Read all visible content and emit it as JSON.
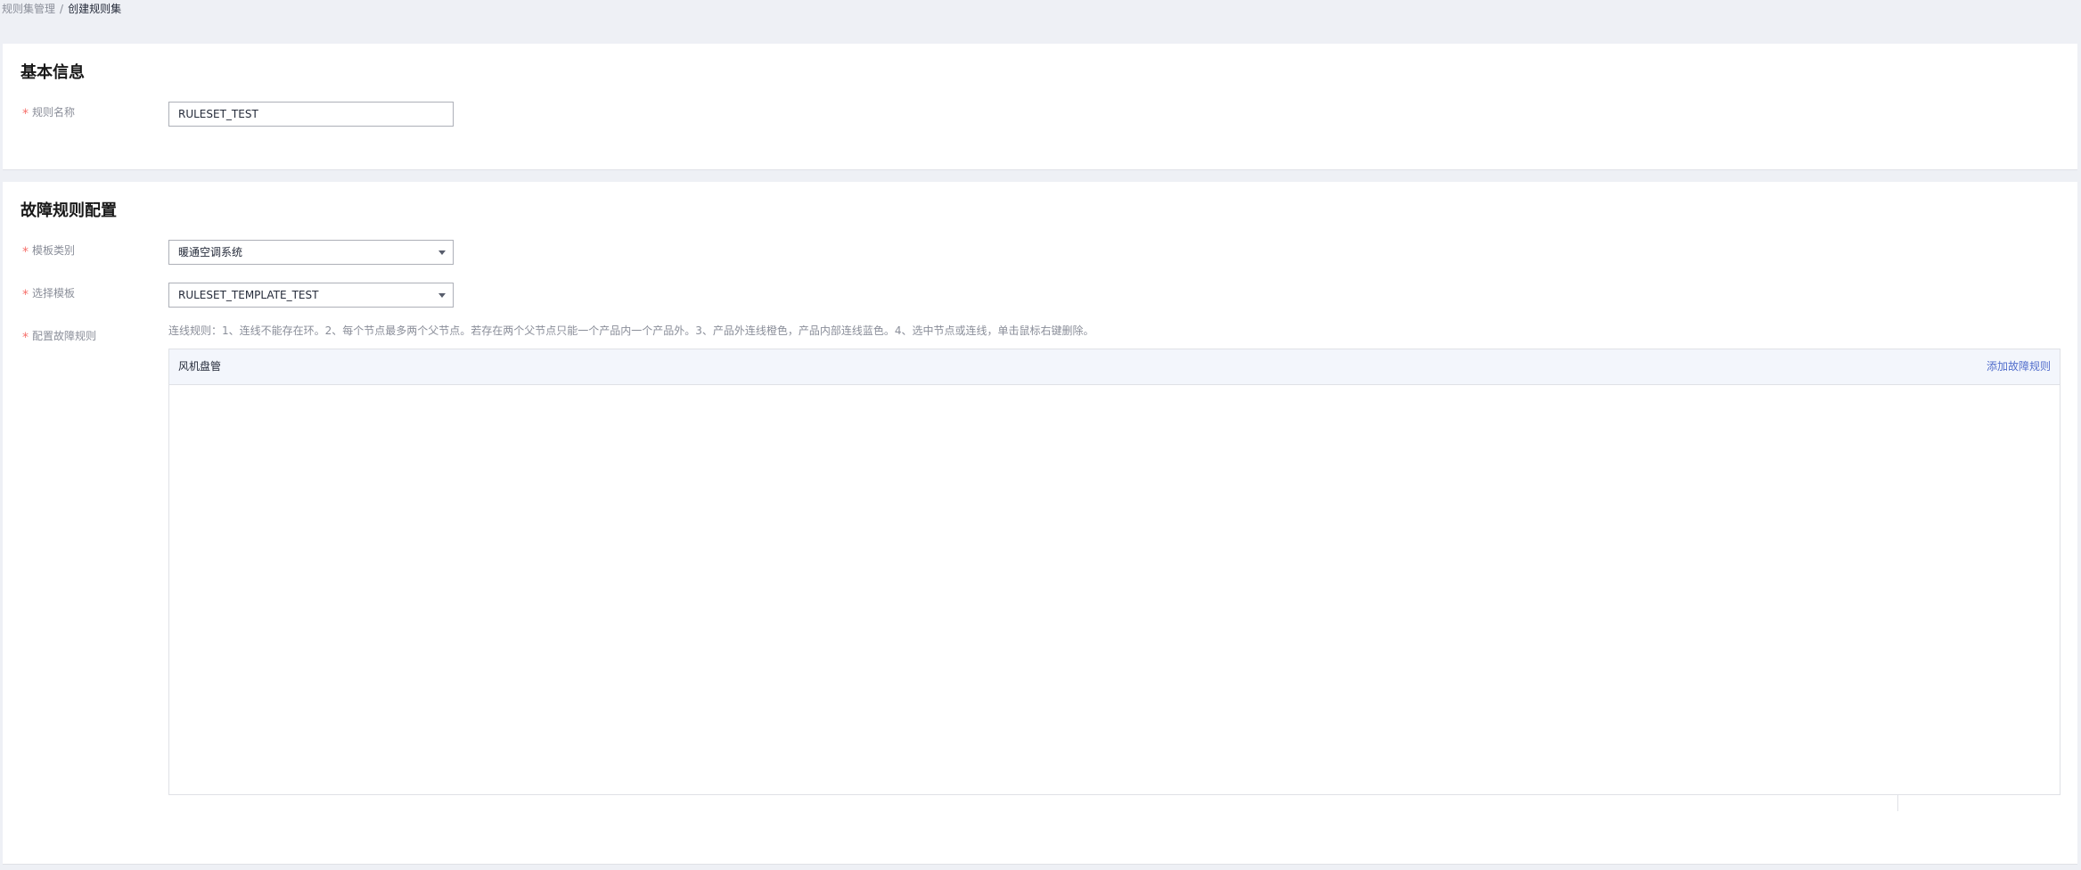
{
  "breadcrumb": {
    "parent": "规则集管理",
    "separator": "/",
    "current": "创建规则集"
  },
  "basic_info": {
    "title": "基本信息",
    "rule_name_label": "规则名称",
    "rule_name_value": "RULESET_TEST",
    "required_mark": "*"
  },
  "fault_config": {
    "title": "故障规则配置",
    "required_mark": "*",
    "template_type_label": "模板类别",
    "template_type_value": "暖通空调系统",
    "select_template_label": "选择模板",
    "select_template_value": "RULESET_TEMPLATE_TEST",
    "config_rules_label": "配置故障规则",
    "hint": "连线规则：1、连线不能存在环。2、每个节点最多两个父节点。若存在两个父节点只能一个产品内一个产品外。3、产品外连线橙色，产品内部连线蓝色。4、选中节点或连线，单击鼠标右键删除。",
    "panel_title": "风机盘管",
    "add_rule_link": "添加故障规则"
  },
  "colors": {
    "page_bg": "#eef0f5",
    "card_bg": "#ffffff",
    "required": "#f66f6a",
    "link": "#526ecc",
    "panel_header_bg": "#f3f6fc"
  }
}
